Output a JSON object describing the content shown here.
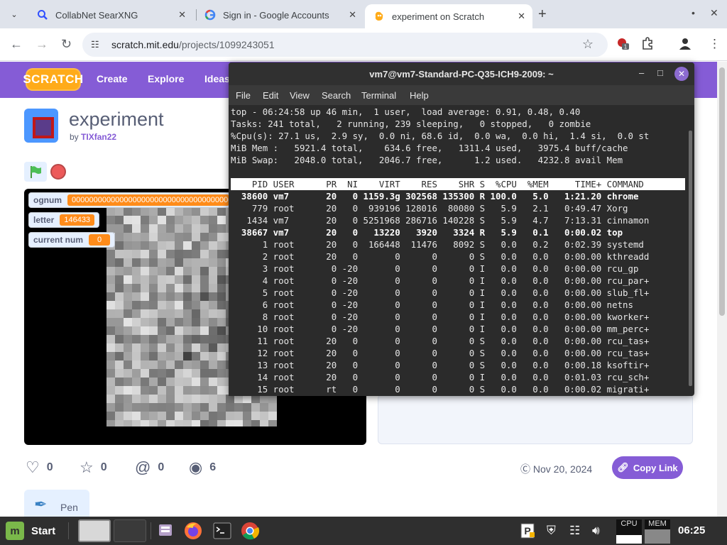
{
  "browser": {
    "tabs": [
      {
        "title": "CollabNet SearXNG",
        "icon": "search-icon",
        "active": false
      },
      {
        "title": "Sign in - Google Accounts",
        "icon": "google-icon",
        "active": false
      },
      {
        "title": "experiment on Scratch",
        "icon": "scratch-icon",
        "active": true
      }
    ],
    "url_host": "scratch.mit.edu",
    "url_path": "/projects/1099243051",
    "extension_badge": "1"
  },
  "scratch": {
    "logo": "SCRATCH",
    "nav": [
      "Create",
      "Explore",
      "Ideas"
    ],
    "project_title": "experiment",
    "by_prefix": "by",
    "author": "TIXfan22",
    "monitors": [
      {
        "label": "ognum",
        "value": "0000000000000000000000000000000000000000000000"
      },
      {
        "label": "letter",
        "value": "146433"
      },
      {
        "label": "current num",
        "value": "0"
      }
    ],
    "stats": {
      "loves": "0",
      "favorites": "0",
      "remixes": "0",
      "views": "6"
    },
    "date": "Nov 20, 2024",
    "copy_link": "Copy Link",
    "extension_label": "Pen"
  },
  "terminal": {
    "title": "vm7@vm7-Standard-PC-Q35-ICH9-2009: ~",
    "menu": [
      "File",
      "Edit",
      "View",
      "Search",
      "Terminal",
      "Help"
    ],
    "summary": [
      "top - 06:24:58 up 46 min,  1 user,  load average: 0.91, 0.48, 0.40",
      "Tasks: 241 total,   2 running, 239 sleeping,   0 stopped,   0 zombie",
      "%Cpu(s): 27.1 us,  2.9 sy,  0.0 ni, 68.6 id,  0.0 wa,  0.0 hi,  1.4 si,  0.0 st",
      "MiB Mem :   5921.4 total,    634.6 free,   1311.4 used,   3975.4 buff/cache",
      "MiB Swap:   2048.0 total,   2046.7 free,      1.2 used.   4232.8 avail Mem"
    ],
    "header": "    PID USER      PR  NI    VIRT    RES    SHR S  %CPU  %MEM     TIME+ COMMAND",
    "processes": [
      {
        "line": "  38600 vm7       20   0 1159.3g 302568 135300 R 100.0   5.0   1:21.20 chrome",
        "bold": true
      },
      {
        "line": "    779 root      20   0  939196 128016  80080 S   5.9   2.1   0:49.47 Xorg",
        "bold": false
      },
      {
        "line": "   1434 vm7       20   0 5251968 286716 140228 S   5.9   4.7   7:13.31 cinnamon",
        "bold": false
      },
      {
        "line": "  38667 vm7       20   0   13220   3920   3324 R   5.9   0.1   0:00.02 top",
        "bold": true
      },
      {
        "line": "      1 root      20   0  166448  11476   8092 S   0.0   0.2   0:02.39 systemd",
        "bold": false
      },
      {
        "line": "      2 root      20   0       0      0      0 S   0.0   0.0   0:00.00 kthreadd",
        "bold": false
      },
      {
        "line": "      3 root       0 -20       0      0      0 I   0.0   0.0   0:00.00 rcu_gp",
        "bold": false
      },
      {
        "line": "      4 root       0 -20       0      0      0 I   0.0   0.0   0:00.00 rcu_par+",
        "bold": false
      },
      {
        "line": "      5 root       0 -20       0      0      0 I   0.0   0.0   0:00.00 slub_fl+",
        "bold": false
      },
      {
        "line": "      6 root       0 -20       0      0      0 I   0.0   0.0   0:00.00 netns",
        "bold": false
      },
      {
        "line": "      8 root       0 -20       0      0      0 I   0.0   0.0   0:00.00 kworker+",
        "bold": false
      },
      {
        "line": "     10 root       0 -20       0      0      0 I   0.0   0.0   0:00.00 mm_perc+",
        "bold": false
      },
      {
        "line": "     11 root      20   0       0      0      0 S   0.0   0.0   0:00.00 rcu_tas+",
        "bold": false
      },
      {
        "line": "     12 root      20   0       0      0      0 S   0.0   0.0   0:00.00 rcu_tas+",
        "bold": false
      },
      {
        "line": "     13 root      20   0       0      0      0 S   0.0   0.0   0:00.18 ksoftir+",
        "bold": false
      },
      {
        "line": "     14 root      20   0       0      0      0 I   0.0   0.0   0:01.03 rcu_sch+",
        "bold": false
      },
      {
        "line": "     15 root      rt   0       0      0      0 S   0.0   0.0   0:00.02 migrati+",
        "bold": false
      }
    ]
  },
  "taskbar": {
    "start_label": "Start",
    "cpu_label": "CPU",
    "mem_label": "MEM",
    "clock": "06:25"
  }
}
